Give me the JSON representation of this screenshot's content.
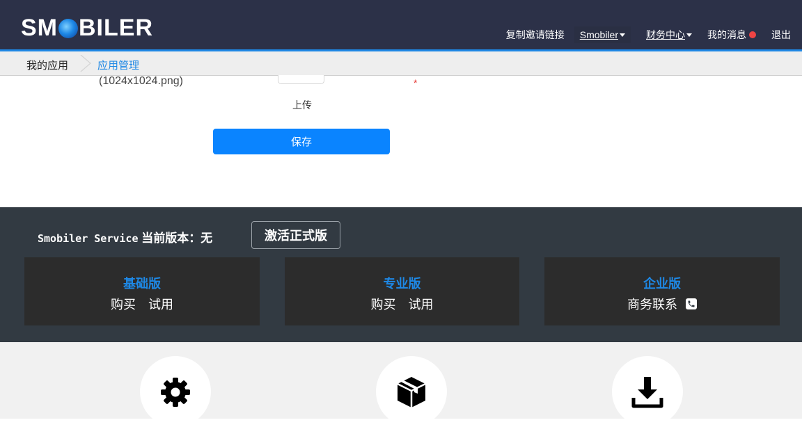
{
  "header": {
    "logo_left": "SM",
    "logo_right": "BILER",
    "nav": {
      "copy_invite": "复制邀请链接",
      "smobiler": "Smobiler",
      "finance": "财务中心",
      "messages": "我的消息",
      "logout": "退出"
    },
    "accent_color": "#1e88e5",
    "badge_color": "#ef4444"
  },
  "breadcrumb": {
    "items": [
      "我的应用",
      "应用管理"
    ]
  },
  "form": {
    "icon_size_note": "(1024x1024.png)",
    "required_mark": "*",
    "upload_label": "上传",
    "save_label": "保存",
    "save_color": "#0a84ff"
  },
  "service": {
    "title_prefix": "Smobiler Service",
    "title_suffix": "当前版本：无",
    "activate_label": "激活正式版",
    "plans": [
      {
        "name": "基础版",
        "actions": [
          "购买",
          "试用"
        ]
      },
      {
        "name": "专业版",
        "actions": [
          "购买",
          "试用"
        ]
      },
      {
        "name": "企业版",
        "actions": [
          "商务联系"
        ],
        "icon": "phone-icon"
      }
    ]
  },
  "features": {
    "icons": [
      "gear-icon",
      "package-icon",
      "download-icon"
    ]
  }
}
